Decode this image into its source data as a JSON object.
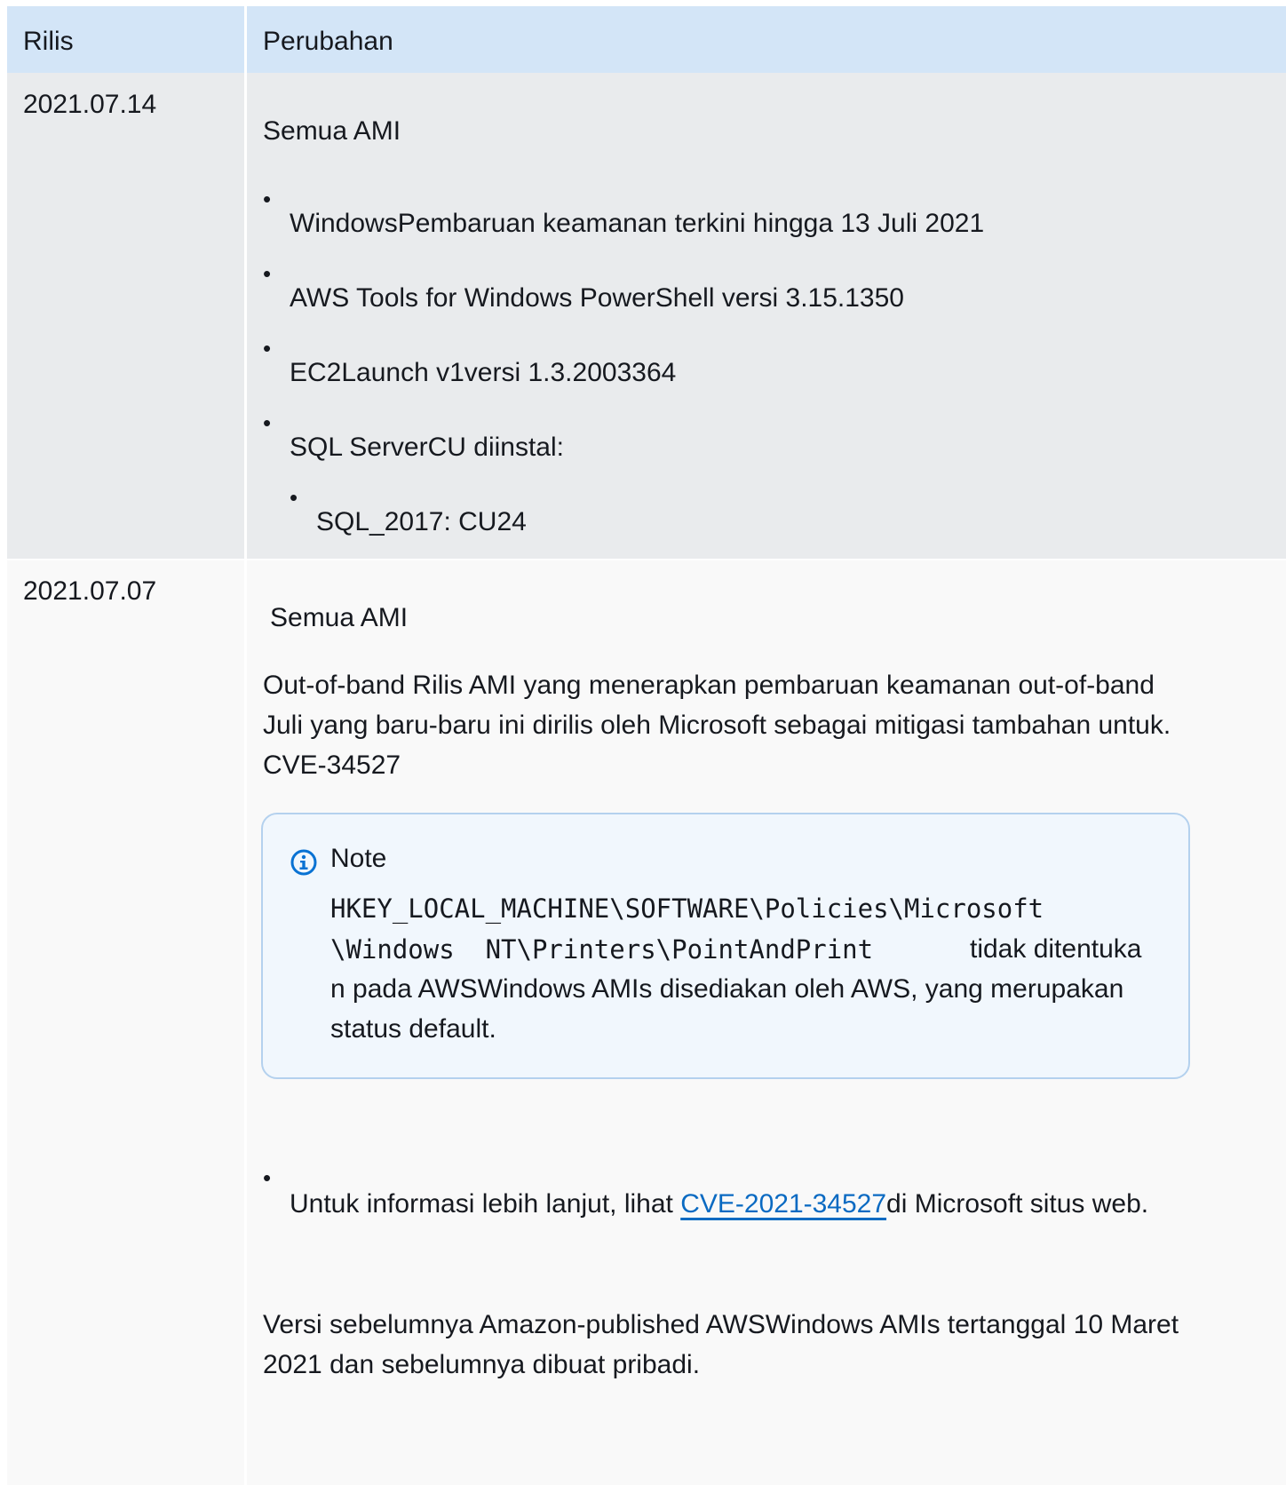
{
  "header": {
    "col1": "Rilis",
    "col2": "Perubahan"
  },
  "rows": [
    {
      "release": "2021.07.14",
      "heading": "Semua AMI",
      "items": [
        "WindowsPembaruan keamanan terkini hingga 13 Juli 2021",
        "AWS Tools for Windows PowerShell versi 3.15.1350",
        "EC2Launch v1versi 1.3.2003364",
        "SQL ServerCU diinstal:"
      ],
      "subitems": [
        "SQL_2017: CU24"
      ]
    },
    {
      "release": "2021.07.07",
      "heading": "Semua AMI",
      "para_lines": [
        "Out-of-band Rilis AMI yang menerapkan pembaruan keamanan out-of-band",
        "Juli yang baru-baru ini dirilis oleh Microsoft sebagai mitigasi tambahan untuk.",
        "CVE-34527"
      ],
      "note": {
        "title": "Note",
        "code_line1": "HKEY_LOCAL_MACHINE\\SOFTWARE\\Policies\\Microsoft",
        "code_line2": "\\Windows  NT\\Printers\\PointAndPrint",
        "text_after_code": "tidak ditentuka",
        "text_line2": "n pada AWSWindows AMIs disediakan oleh AWS, yang merupakan",
        "text_line3": "status default."
      },
      "more_info": {
        "prefix": "Untuk informasi lebih lanjut, lihat ",
        "link": "CVE-2021-34527",
        "suffix": "di Microsoft situs web."
      },
      "footer_lines": [
        "Versi sebelumnya Amazon-published AWSWindows AMIs tertanggal 10 Maret",
        "2021 dan sebelumnya dibuat pribadi."
      ]
    }
  ],
  "icons": {
    "note": "info-icon"
  },
  "colors": {
    "header_bg": "#d3e5f7",
    "row1_bg": "#e9ebed",
    "note_border": "#b4d1ee",
    "link": "#0a6ac2",
    "info_icon": "#0972d3"
  }
}
